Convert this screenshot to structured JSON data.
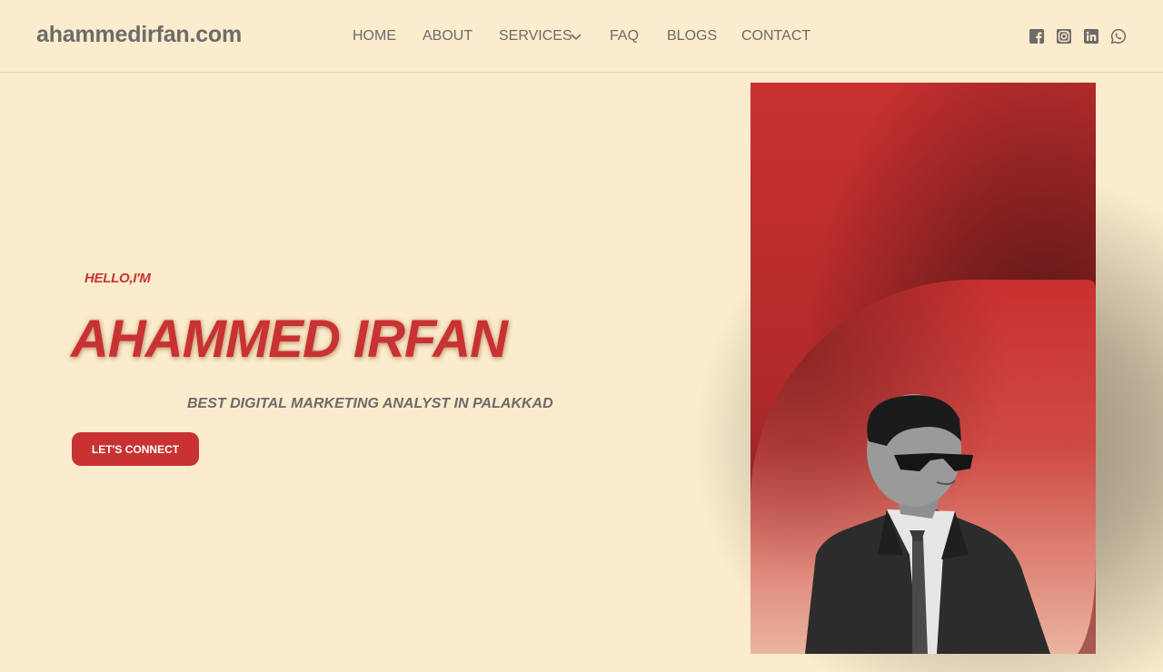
{
  "header": {
    "site_title": "ahammedirfan.com",
    "nav": [
      {
        "label": "HOME"
      },
      {
        "label": "ABOUT"
      },
      {
        "label": "SERVICES",
        "has_dropdown": true
      },
      {
        "label": "FAQ"
      },
      {
        "label": "BLOGS"
      },
      {
        "label": "CONTACT"
      }
    ],
    "social_icons": [
      "facebook-icon",
      "instagram-icon",
      "linkedin-icon",
      "whatsapp-icon"
    ]
  },
  "hero": {
    "greeting": "HELLO,I'M",
    "name": "AHAMMED IRFAN",
    "tagline": "BEST DIGITAL MARKETING ANALYST IN PALAKKAD",
    "cta_label": "LET'S CONNECT"
  },
  "colors": {
    "background": "#faeccd",
    "accent": "#c83232",
    "text": "#6f6a6a"
  }
}
